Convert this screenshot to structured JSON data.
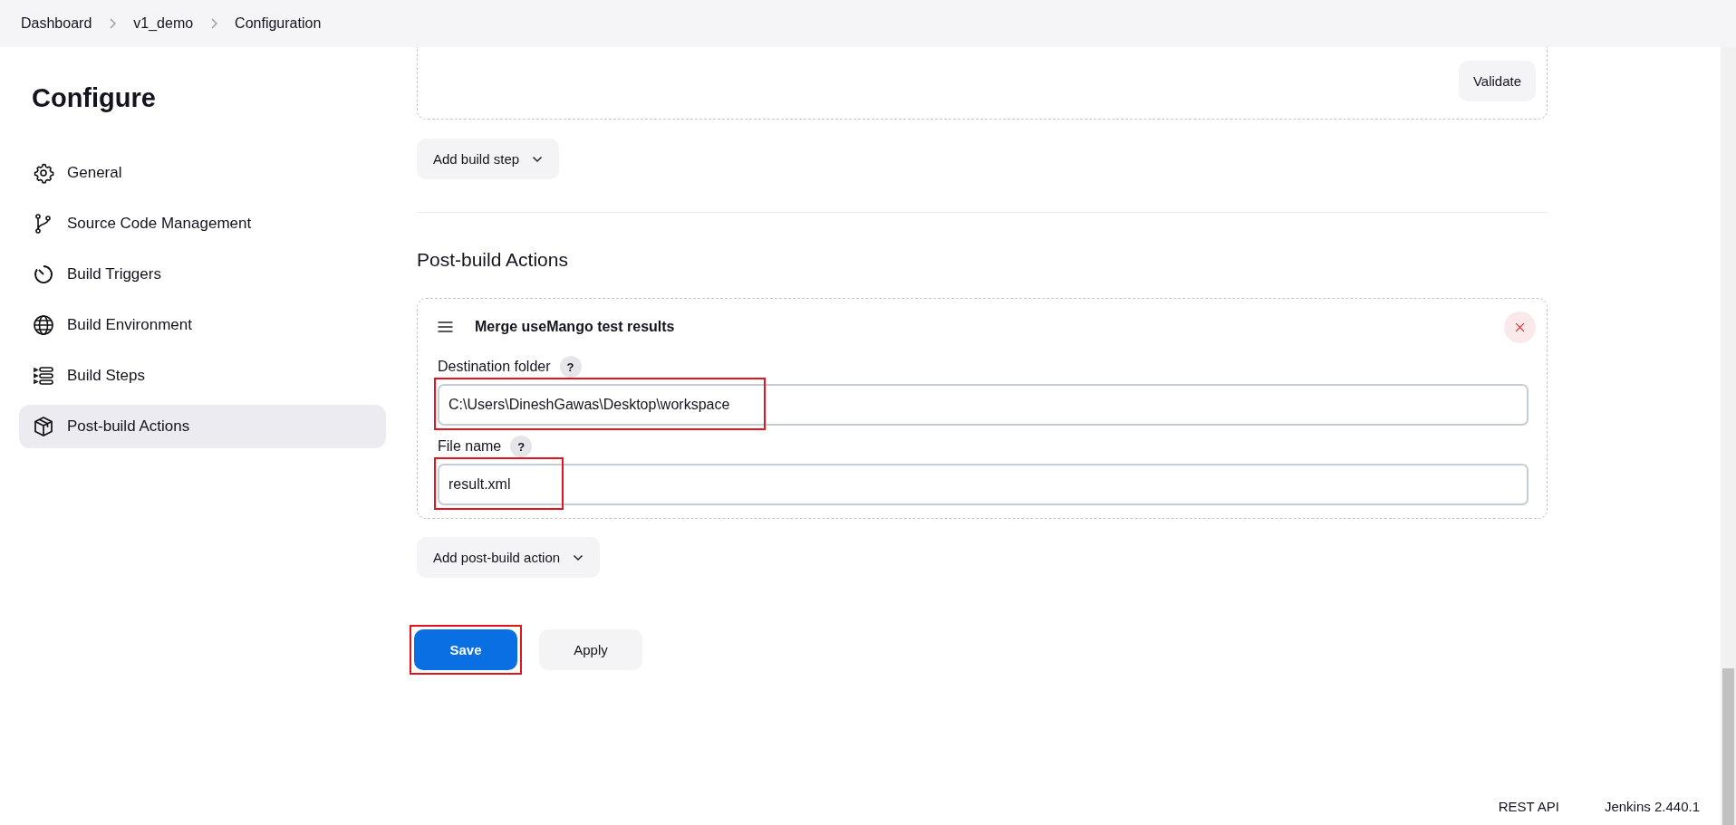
{
  "breadcrumbs": [
    {
      "label": "Dashboard"
    },
    {
      "label": "v1_demo"
    },
    {
      "label": "Configuration"
    }
  ],
  "sidebar": {
    "title": "Configure",
    "items": [
      {
        "label": "General",
        "kind": "gear",
        "selected": false
      },
      {
        "label": "Source Code Management",
        "kind": "branch",
        "selected": false
      },
      {
        "label": "Build Triggers",
        "kind": "timer",
        "selected": false
      },
      {
        "label": "Build Environment",
        "kind": "globe",
        "selected": false
      },
      {
        "label": "Build Steps",
        "kind": "steps",
        "selected": false
      },
      {
        "label": "Post-build Actions",
        "kind": "package",
        "selected": true
      }
    ]
  },
  "build_steps": {
    "validate_button": "Validate",
    "add_button": "Add build step"
  },
  "post_build": {
    "heading": "Post-build Actions",
    "action": {
      "title": "Merge useMango test results",
      "fields": [
        {
          "label": "Destination folder",
          "help": "?",
          "value": "C:\\Users\\DineshGawas\\Desktop\\workspace",
          "highlighted": true
        },
        {
          "label": "File name",
          "help": "?",
          "value": "result.xml",
          "highlighted": true
        }
      ]
    },
    "add_button": "Add post-build action"
  },
  "buttons": [
    {
      "label": "Save",
      "kind": "primary",
      "highlighted": true
    },
    {
      "label": "Apply",
      "kind": "secondary",
      "highlighted": false
    }
  ],
  "footer": {
    "links": [
      "REST API",
      "Jenkins 2.440.1"
    ]
  }
}
